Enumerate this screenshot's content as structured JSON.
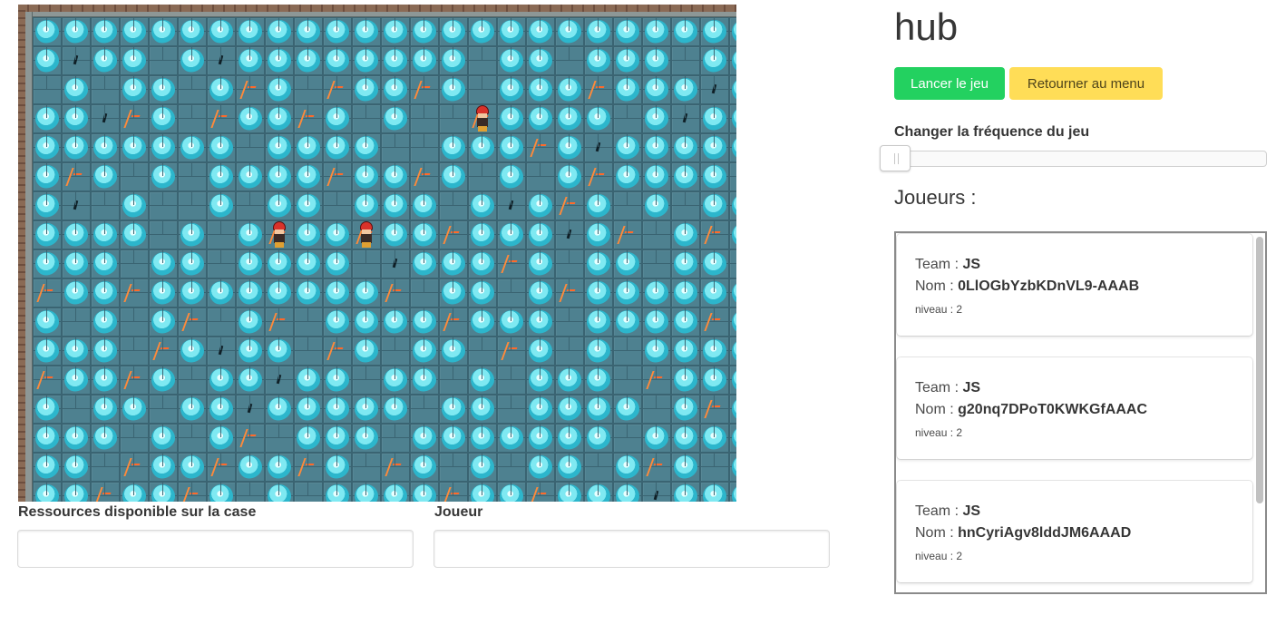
{
  "app": {
    "title": "hub"
  },
  "buttons": {
    "start_label": "Lancer le jeu",
    "menu_label": "Retourner au menu"
  },
  "frequency": {
    "label": "Changer la fréquence du jeu",
    "value_fraction": 0.0
  },
  "players_panel": {
    "title": "Joueurs :",
    "players": [
      {
        "team_label": "Team :",
        "team": "JS",
        "name_label": "Nom :",
        "name": "0LlOGbYzbKDnVL9-AAAB",
        "level_label": "niveau : 2"
      },
      {
        "team_label": "Team :",
        "team": "JS",
        "name_label": "Nom :",
        "name": "g20nq7DPoT0KWKGfAAAC",
        "level_label": "niveau : 2"
      },
      {
        "team_label": "Team :",
        "team": "JS",
        "name_label": "Nom :",
        "name": "hnCyriAgv8lddJM6AAAD",
        "level_label": "niveau : 2"
      }
    ]
  },
  "info": {
    "resources_label": "Ressources disponible sur la case",
    "player_label": "Joueur",
    "resources_value": "",
    "player_value": ""
  },
  "board": {
    "cols": 25,
    "rows": 17,
    "rows_data": [
      "CCCCCCCCCCCCCCCCCCCCCCCCC",
      "c.cc.c.cccccccc.cc.ccc.cc",
      ".c.cc.c.c..cc.c.ccc.ccc.c",
      "cc..c..cc.c.c...cccc.c.cc",
      "ccccccc.cccc..ccc.c.ccccc",
      "c.c.c.cccc.cc.c.c.c.cccc.",
      "c..c..c.cc.ccc.c.c.c.c.cc",
      "cccc.c.c.cc.cc.ccc.c..c.c",
      "ccc.cc.cccc..ccc.c.cc.cc.",
      ".cc.cccccccc..cc.c.cccccc",
      "c.c.c..c..cccc.ccc.cccc.c",
      "ccc..c.cc..c.cc..c.c.cccc",
      ".cc.c.cc.cc.cc.c.ccc..ccc",
      "c.cc.cc.ccccc.cc.cccc.c.c",
      "ccc.c.c..ccc.ccccccc.cccc",
      "cc..cc.cc.c..c.c.cc.c.c.c",
      "cc.cc.c.c.cccc.cc.ccc.ccc"
    ],
    "crystal_color": "#2cb6cc",
    "crack_color": "#ff8a3a",
    "players_on_board": [
      {
        "col": 15,
        "row": 3,
        "icon": "trainer-red-cap-icon"
      },
      {
        "col": 8,
        "row": 7,
        "icon": "trainer-red-cap-icon"
      },
      {
        "col": 11,
        "row": 7,
        "icon": "trainer-red-cap-icon"
      }
    ]
  },
  "colors": {
    "start_button": "#23d160",
    "menu_button": "#ffdd57",
    "tile": "#4e8190"
  }
}
